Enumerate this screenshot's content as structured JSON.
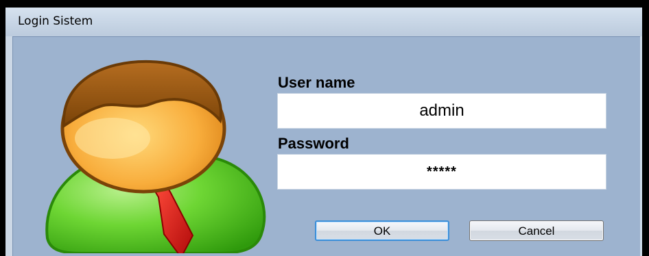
{
  "window": {
    "title": "Login Sistem"
  },
  "avatar": {
    "icon": "user-avatar-icon"
  },
  "form": {
    "username_label": "User name",
    "username_value": "admin",
    "password_label": "Password",
    "password_value": "*****",
    "ok_label": "OK",
    "cancel_label": "Cancel"
  },
  "colors": {
    "client_background": "#9db3cf",
    "avatar_hair": "#9a5a14",
    "avatar_face": "#f6a83a",
    "avatar_shirt": "#55c81e",
    "avatar_tie": "#d81414",
    "ok_button_border": "#3c8fd8"
  }
}
